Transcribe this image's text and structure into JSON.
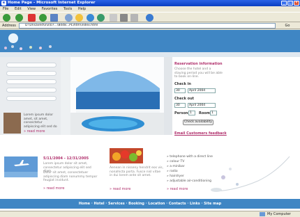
{
  "window": {
    "title": "Home Page - Microsoft Internet Explorer",
    "icon": "ie-icon"
  },
  "menu": [
    "File",
    "Edit",
    "View",
    "Favorites",
    "Tools",
    "Help"
  ],
  "toolbar": {
    "icons": [
      "back-icon",
      "forward-icon",
      "stop-icon",
      "refresh-icon",
      "home-icon",
      "search-icon",
      "favorites-icon",
      "media-icon",
      "history-icon",
      "mail-icon",
      "print-icon",
      "edit-icon",
      "messenger-icon"
    ]
  },
  "address": {
    "label": "Address",
    "value": "D:\\Unsaved\\x\\x\\07...\\8448...PL\\htm\\index.html",
    "go": "Go"
  },
  "page": {
    "reservation": {
      "title": "Reservation information",
      "text": "Choose the hotel and a staying period you will be able to book on-line.",
      "checkin_label": "Check in",
      "checkin_day": "30",
      "checkin_month": "April 2004",
      "checkout_label": "Check out",
      "checkout_day": "30",
      "checkout_month": "April 2004",
      "persons_label": "Persons",
      "persons_value": "1",
      "rooms_label": "Rooms",
      "rooms_value": "1",
      "check_button": "Check availability",
      "feedback_link": "Email Customers feedback"
    },
    "promo": {
      "text": "Lorem ipsum dolor amet, sit amet, consectetur adipiscing elit sed do",
      "read_more": "read more"
    },
    "news1": {
      "date": "5/11/2004 - 12/31/2005",
      "text1": "Lorem ipsum dolor sit amet, consectetur adipiscing elit sed diam.",
      "text2": "Dolor sit amet, consectetuer adipiscing diam nonummy tempor feugiat invidunt.",
      "read_more": "read more"
    },
    "news2": {
      "text": "Aenean in nisseny hendrit eos vis, nonahicta porta. Fusce nisl vitae in dui lorem ante sit amet.",
      "read_more": "read more"
    },
    "features": [
      "telephone with a direct line",
      "colour TV",
      "a minibar",
      "radio",
      "hairdryer",
      "adjustable air-conditioning"
    ],
    "features_read_more": "read more",
    "footer_links": [
      "Home",
      "Hotel",
      "Services",
      "Booking",
      "Location",
      "Contacts",
      "Links",
      "Site map"
    ]
  },
  "status": {
    "left": "",
    "right": "My Computer"
  }
}
